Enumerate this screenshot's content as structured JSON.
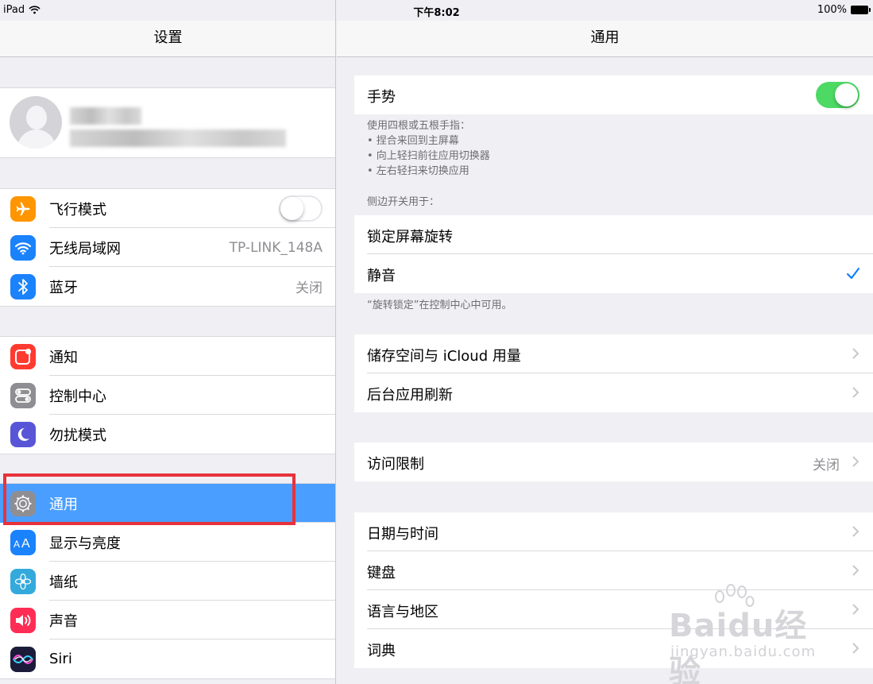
{
  "status_bar": {
    "device": "iPad",
    "time": "下午8:02",
    "battery": "100%"
  },
  "left": {
    "title": "设置",
    "group1": [
      {
        "label": "飞行模式",
        "icon": "airplane-icon",
        "color": "#ff9500",
        "toggle": "off"
      },
      {
        "label": "无线局域网",
        "icon": "wifi-icon",
        "color": "#1a82fb",
        "value": "TP-LINK_148A"
      },
      {
        "label": "蓝牙",
        "icon": "bluetooth-icon",
        "color": "#1a82fb",
        "value": "关闭"
      }
    ],
    "group2": [
      {
        "label": "通知",
        "icon": "notifications-icon",
        "color": "#ff3b30"
      },
      {
        "label": "控制中心",
        "icon": "control-center-icon",
        "color": "#8e8e93"
      },
      {
        "label": "勿扰模式",
        "icon": "moon-icon",
        "color": "#5856d6"
      }
    ],
    "group3": [
      {
        "label": "通用",
        "icon": "gear-icon",
        "color": "#8e8e93",
        "selected": true
      },
      {
        "label": "显示与亮度",
        "icon": "display-icon",
        "color": "#1a82fb"
      },
      {
        "label": "墙纸",
        "icon": "wallpaper-icon",
        "color": "#34aadc"
      },
      {
        "label": "声音",
        "icon": "sound-icon",
        "color": "#ff2d55"
      },
      {
        "label": "Siri",
        "icon": "siri-icon",
        "color": "#1c1c3a"
      }
    ]
  },
  "right": {
    "title": "通用",
    "gesture": {
      "label": "手势",
      "toggle": "on"
    },
    "gesture_footer": [
      "使用四根或五根手指：",
      "• 捏合来回到主屏幕",
      "• 向上轻扫前往应用切换器",
      "• 左右轻扫来切换应用"
    ],
    "side_switch_header": "侧边开关用于：",
    "side_switch": [
      {
        "label": "锁定屏幕旋转"
      },
      {
        "label": "静音",
        "checked": true
      }
    ],
    "side_switch_footer": "“旋转锁定”在控制中心中可用。",
    "storage_group": [
      {
        "label": "储存空间与 iCloud 用量"
      },
      {
        "label": "后台应用刷新"
      }
    ],
    "restrictions": {
      "label": "访问限制",
      "value": "关闭"
    },
    "datetime_group": [
      {
        "label": "日期与时间"
      },
      {
        "label": "键盘"
      },
      {
        "label": "语言与地区"
      },
      {
        "label": "词典"
      }
    ]
  },
  "watermark": {
    "brand": "Baidu经验",
    "url": "jingyan.baidu.com"
  },
  "colors": {
    "selection": "#4a9eff",
    "toggle_on": "#4cd964",
    "highlight_box": "#e8323a",
    "checkmark": "#007aff"
  }
}
